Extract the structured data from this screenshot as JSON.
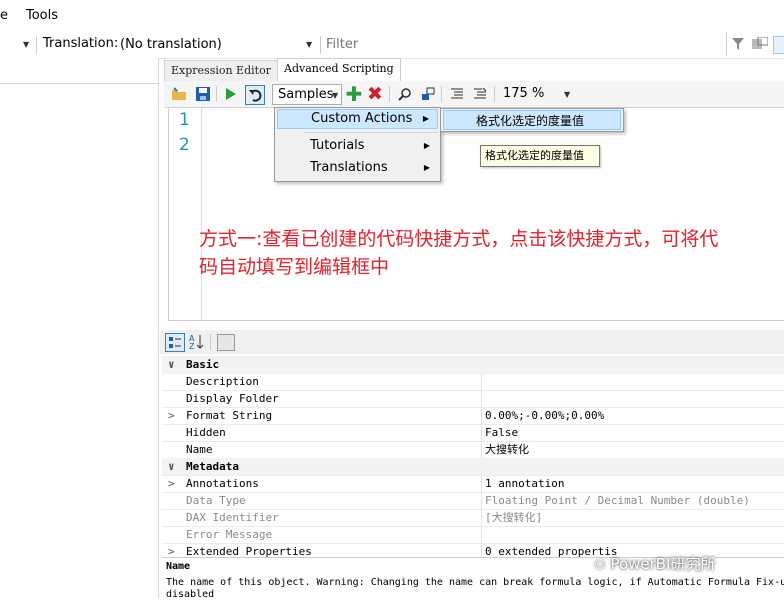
{
  "menubar": {
    "partial_item": "e",
    "tools": "Tools"
  },
  "toolbar": {
    "translation_label": "Translation:",
    "translation_value": "(No translation)",
    "filter_placeholder": "Filter"
  },
  "tabs": [
    {
      "label": "Expression Editor",
      "active": false
    },
    {
      "label": "Advanced Scripting",
      "active": true
    }
  ],
  "editor_toolbar": {
    "samples_label": "Samples",
    "zoom": "175 %"
  },
  "editor": {
    "line_numbers": [
      "1",
      "2"
    ]
  },
  "menu": {
    "items": [
      "Custom Actions",
      "Tutorials",
      "Translations"
    ],
    "submenu_item": "格式化选定的度量值",
    "tooltip": "格式化选定的度量值"
  },
  "annotation": {
    "line1": "方式一:查看已创建的代码快捷方式，点击该快捷方式，可将代",
    "line2": "码自动填写到编辑框中"
  },
  "properties": {
    "rows": [
      {
        "kind": "cat",
        "expander": "∨",
        "name": "Basic",
        "value": ""
      },
      {
        "kind": "prop",
        "expander": "",
        "name": "Description",
        "value": ""
      },
      {
        "kind": "prop",
        "expander": "",
        "name": "Display Folder",
        "value": ""
      },
      {
        "kind": "prop",
        "expander": ">",
        "name": "Format String",
        "value": "0.00%;-0.00%;0.00%"
      },
      {
        "kind": "prop",
        "expander": "",
        "name": "Hidden",
        "value": "False"
      },
      {
        "kind": "prop",
        "expander": "",
        "name": "Name",
        "value": "大搜转化"
      },
      {
        "kind": "cat",
        "expander": "∨",
        "name": "Metadata",
        "value": ""
      },
      {
        "kind": "prop",
        "expander": ">",
        "name": "Annotations",
        "value": "1 annotation"
      },
      {
        "kind": "dim",
        "expander": "",
        "name": "Data Type",
        "value": "Floating Point / Decimal Number (double)"
      },
      {
        "kind": "dim",
        "expander": "",
        "name": "DAX Identifier",
        "value": "[大搜转化]"
      },
      {
        "kind": "dim",
        "expander": "",
        "name": "Error Message",
        "value": ""
      },
      {
        "kind": "prop",
        "expander": ">",
        "name": "Extended Properties",
        "value": "0 extended propertis"
      }
    ]
  },
  "description": {
    "title": "Name",
    "text": "The name of this object. Warning: Changing the name can break formula logic, if Automatic Formula Fix-u",
    "text2": "disabled"
  },
  "watermark": "PowerBI研究所",
  "colors": {
    "menu_highlight": "#cce8ff",
    "annotation": "#e8202b",
    "line_number": "#2b91af"
  }
}
